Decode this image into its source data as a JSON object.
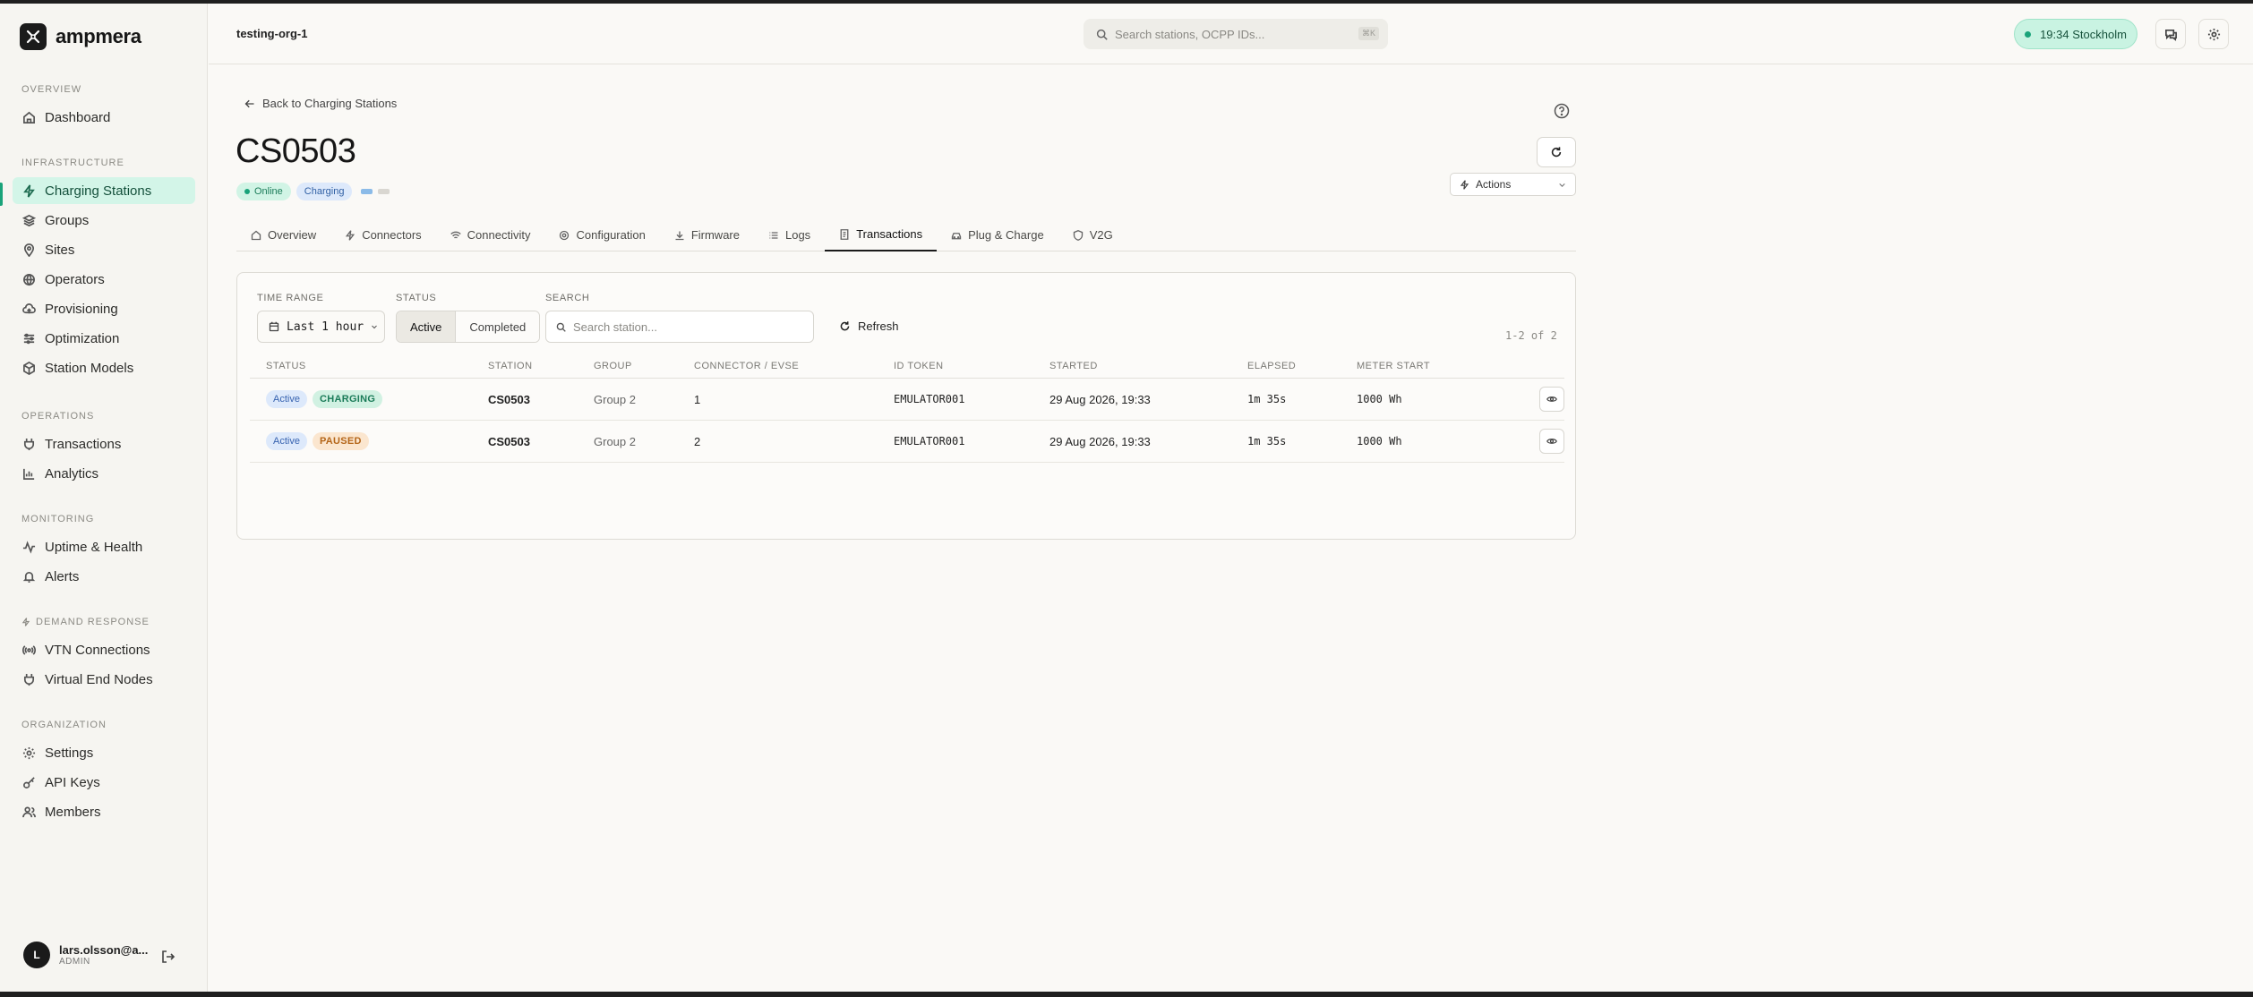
{
  "brand": {
    "name": "ampmera"
  },
  "header": {
    "org": "testing-org-1",
    "search_placeholder": "Search stations, OCPP IDs...",
    "search_shortcut": "⌘K",
    "clock": "19:34 Stockholm"
  },
  "sidebar": {
    "sections": [
      {
        "heading": "OVERVIEW",
        "items": [
          {
            "label": "Dashboard",
            "icon": "home-icon"
          }
        ]
      },
      {
        "heading": "INFRASTRUCTURE",
        "items": [
          {
            "label": "Charging Stations",
            "icon": "zap-icon",
            "active": true
          },
          {
            "label": "Groups",
            "icon": "layers-icon"
          },
          {
            "label": "Sites",
            "icon": "map-pin-icon"
          },
          {
            "label": "Operators",
            "icon": "globe-icon"
          },
          {
            "label": "Provisioning",
            "icon": "cloud-icon"
          },
          {
            "label": "Optimization",
            "icon": "sliders-icon"
          },
          {
            "label": "Station Models",
            "icon": "box-icon"
          }
        ]
      },
      {
        "heading": "OPERATIONS",
        "items": [
          {
            "label": "Transactions",
            "icon": "plug-icon"
          },
          {
            "label": "Analytics",
            "icon": "bar-chart-icon"
          }
        ]
      },
      {
        "heading": "MONITORING",
        "items": [
          {
            "label": "Uptime & Health",
            "icon": "activity-icon"
          },
          {
            "label": "Alerts",
            "icon": "bell-icon"
          }
        ]
      },
      {
        "heading": "DEMAND RESPONSE",
        "items": [
          {
            "label": "VTN Connections",
            "icon": "radio-icon"
          },
          {
            "label": "Virtual End Nodes",
            "icon": "plug-icon"
          }
        ]
      },
      {
        "heading": "ORGANIZATION",
        "items": [
          {
            "label": "Settings",
            "icon": "gear-icon"
          },
          {
            "label": "API Keys",
            "icon": "key-icon"
          },
          {
            "label": "Members",
            "icon": "users-icon"
          }
        ]
      }
    ],
    "user": {
      "initial": "L",
      "email": "lars.olsson@a...",
      "role": "ADMIN"
    }
  },
  "page": {
    "back_label": "Back to Charging Stations",
    "title": "CS0503",
    "status_online": "Online",
    "status_charging": "Charging",
    "actions_label": "Actions",
    "tabs": [
      {
        "label": "Overview",
        "icon": "home-icon"
      },
      {
        "label": "Connectors",
        "icon": "zap-icon"
      },
      {
        "label": "Connectivity",
        "icon": "wifi-icon"
      },
      {
        "label": "Configuration",
        "icon": "gear-icon"
      },
      {
        "label": "Firmware",
        "icon": "download-icon"
      },
      {
        "label": "Logs",
        "icon": "list-icon"
      },
      {
        "label": "Transactions",
        "icon": "receipt-icon",
        "active": true
      },
      {
        "label": "Plug & Charge",
        "icon": "car-icon"
      },
      {
        "label": "V2G",
        "icon": "shield-icon"
      }
    ]
  },
  "transactions": {
    "filters": {
      "time_range_label": "TIME RANGE",
      "time_range_value": "Last 1 hour",
      "status_label": "STATUS",
      "status_options": [
        "Active",
        "Completed"
      ],
      "status_selected": "Active",
      "search_label": "SEARCH",
      "search_placeholder": "Search station...",
      "refresh_label": "Refresh"
    },
    "count": "1-2 of 2",
    "columns": [
      "STATUS",
      "STATION",
      "GROUP",
      "CONNECTOR / EVSE",
      "ID TOKEN",
      "STARTED",
      "ELAPSED",
      "METER START"
    ],
    "rows": [
      {
        "status": "Active",
        "state": "CHARGING",
        "station": "CS0503",
        "group": "Group 2",
        "connector": "1",
        "id_token": "EMULATOR001",
        "started": "29 Aug 2026, 19:33",
        "elapsed": "1m 35s",
        "meter_start": "1000 Wh"
      },
      {
        "status": "Active",
        "state": "PAUSED",
        "station": "CS0503",
        "group": "Group 2",
        "connector": "2",
        "id_token": "EMULATOR001",
        "started": "29 Aug 2026, 19:33",
        "elapsed": "1m 35s",
        "meter_start": "1000 Wh"
      }
    ]
  },
  "colors": {
    "accent": "#1aa37a",
    "active_nav_bg": "#d3f5e8",
    "charging_pill": "#d1f1e2",
    "paused_pill": "#fbe6cf",
    "active_pill": "#dde9fb"
  }
}
